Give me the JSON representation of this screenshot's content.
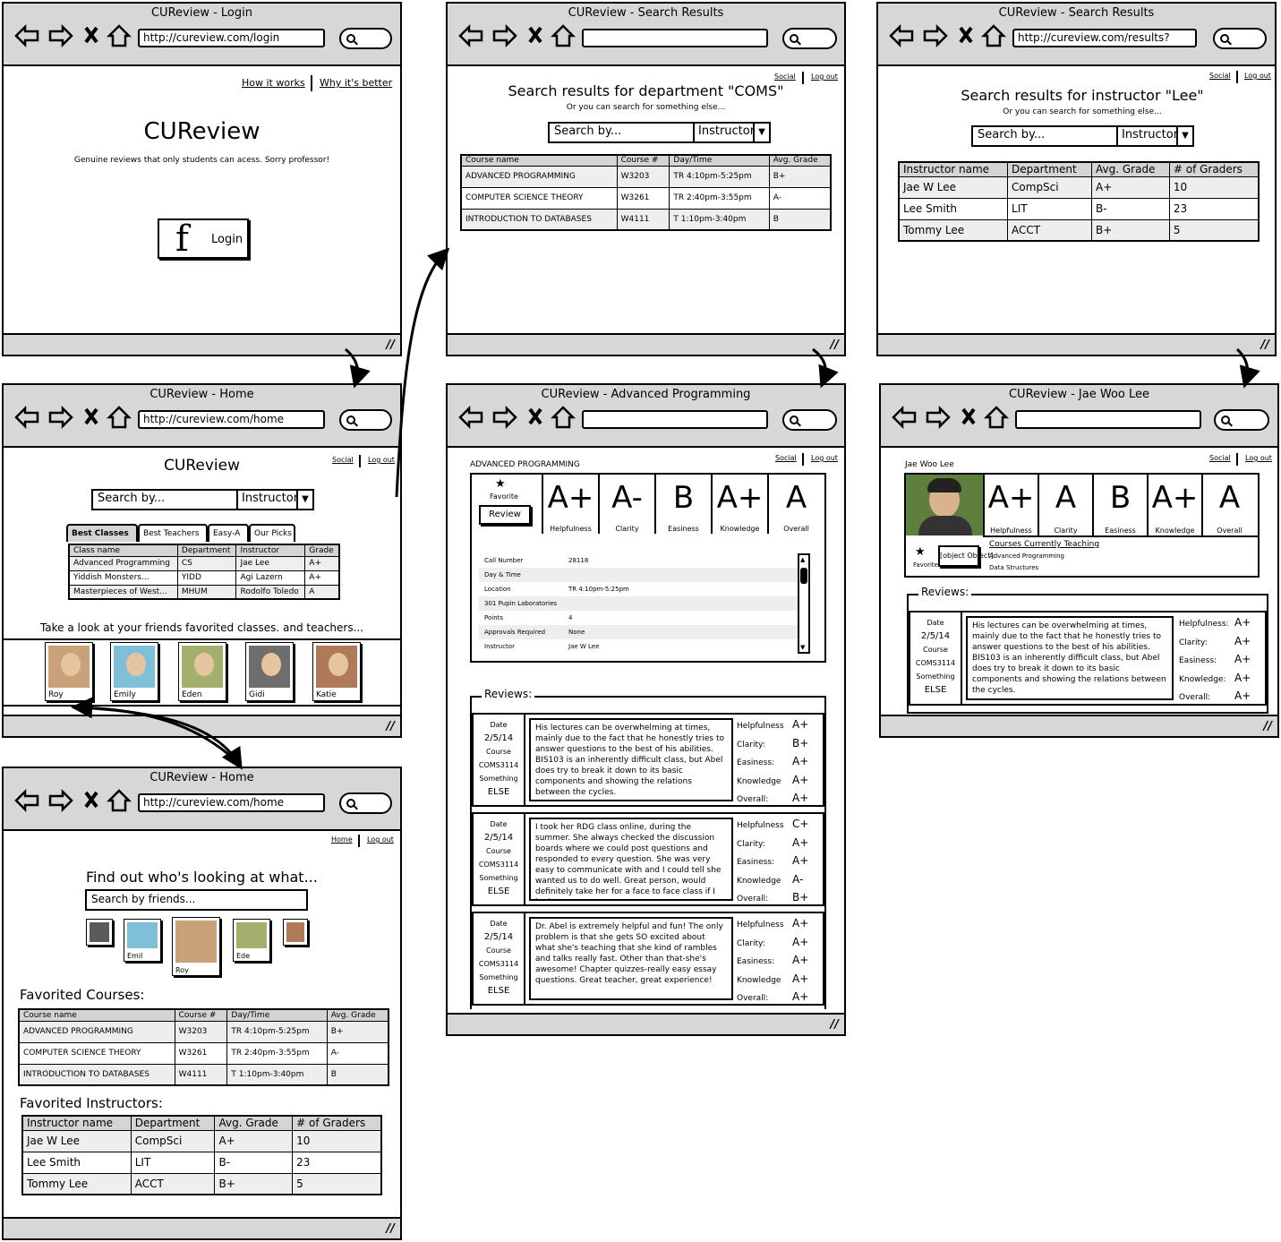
{
  "w1": {
    "title": "CUReview - Login",
    "url": "http://cureview.com/login",
    "link1": "How it works",
    "link2": "Why it's better",
    "heading": "CUReview",
    "tagline": "Genuine reviews that only students can acess. Sorry professor!",
    "login": "Login"
  },
  "w2": {
    "title": "CUReview - Search Results",
    "social": "Social",
    "logout": "Log out",
    "heading": "Search results for department \"COMS\"",
    "sub": "Or you can search for something else...",
    "search_ph": "Search by...",
    "dropdown": "Instructor",
    "headers": [
      "Course name",
      "Course #",
      "Day/Time",
      "Avg. Grade"
    ],
    "rows": [
      [
        "ADVANCED PROGRAMMING",
        "W3203",
        "TR 4:10pm-5:25pm",
        "B+"
      ],
      [
        "COMPUTER SCIENCE THEORY",
        "W3261",
        "TR 2:40pm-3:55pm",
        "A-"
      ],
      [
        "INTRODUCTION TO DATABASES",
        "W4111",
        "T 1:10pm-3:40pm",
        "B"
      ]
    ]
  },
  "w3": {
    "title": "CUReview - Search Results",
    "url": "http://cureview.com/results?",
    "social": "Social",
    "logout": "Log out",
    "heading": "Search results for instructor \"Lee\"",
    "sub": "Or you can search for something else...",
    "search_ph": "Search by...",
    "dropdown": "Instructor",
    "headers": [
      "Instructor name",
      "Department",
      "Avg. Grade",
      "# of Graders"
    ],
    "rows": [
      [
        "Jae W Lee",
        "CompSci",
        "A+",
        "10"
      ],
      [
        "Lee Smith",
        "LIT",
        "B-",
        "23"
      ],
      [
        "Tommy Lee",
        "ACCT",
        "B+",
        "5"
      ]
    ]
  },
  "w4": {
    "title": "CUReview - Home",
    "url": "http://cureview.com/home",
    "social": "Social",
    "logout": "Log out",
    "heading": "CUReview",
    "search_ph": "Search by...",
    "dropdown": "Instructor",
    "tabs": [
      "Best Classes",
      "Best Teachers",
      "Easy-A",
      "Our Picks"
    ],
    "headers": [
      "Class name",
      "Department",
      "Instructor",
      "Grade"
    ],
    "rows": [
      [
        "Advanced Programming",
        "CS",
        "Jae Lee",
        "A+"
      ],
      [
        "Yiddish Monsters...",
        "YIDD",
        "Agi Lazern",
        "A+"
      ],
      [
        "Masterpieces of West...",
        "MHUM",
        "Rodolfo Toledo",
        "A"
      ]
    ],
    "friends_caption": "Take a look at your friends favorited classes. and teachers...",
    "friends": [
      "Roy",
      "Emily",
      "Eden",
      "Gidi",
      "Katie"
    ]
  },
  "w5": {
    "title": "CUReview - Advanced Programming",
    "social": "Social",
    "logout": "Log out",
    "course": "ADVANCED PROGRAMMING",
    "favorite": "Favorite",
    "review": "Review",
    "grades": [
      {
        "g": "A+",
        "l": "Helpfulness"
      },
      {
        "g": "A-",
        "l": "Clarity"
      },
      {
        "g": "B",
        "l": "Easiness"
      },
      {
        "g": "A+",
        "l": "Knowledge"
      },
      {
        "g": "A",
        "l": "Overall"
      }
    ],
    "details": [
      [
        "Call Number",
        "28118"
      ],
      [
        "Day & Time",
        ""
      ],
      [
        "Location",
        "TR 4:10pm-5:25pm"
      ],
      [
        "301 Pupin Laboratories",
        ""
      ],
      [
        "Points",
        "4"
      ],
      [
        "Approvals Required",
        "None"
      ],
      [
        "Instructor",
        "Jae W Lee"
      ]
    ],
    "reviews_label": "Reviews:",
    "reviews": [
      {
        "date_l": "Date",
        "date": "2/5/14",
        "course_l": "Course",
        "course": "COMS3114",
        "s1": "Something",
        "s2": "ELSE",
        "text": "His lectures can be overwhelming at times, mainly due to the fact that he honestly tries to answer questions to the best of his abilities. BIS103 is an inherently difficult class, but Abel does try to break it down to its basic components and showing the relations between the cycles.",
        "r": [
          [
            "Helpfulness",
            "A+"
          ],
          [
            "Clarity:",
            "B+"
          ],
          [
            "Easiness:",
            "A+"
          ],
          [
            "Knowledge",
            "A+"
          ],
          [
            "Overall:",
            "A+"
          ]
        ]
      },
      {
        "date_l": "Date",
        "date": "2/5/14",
        "course_l": "Course",
        "course": "COMS3114",
        "s1": "Something",
        "s2": "ELSE",
        "text": "I took her RDG class online, during the summer. She always checked the discussion boards where we could post questions and responded to every question. She was very easy to communicate with and I could tell she wanted us to do well. Great person, would definitely take her for a face to face class if I had to.",
        "r": [
          [
            "Helpfulness",
            "C+"
          ],
          [
            "Clarity:",
            "A+"
          ],
          [
            "Easiness:",
            "A+"
          ],
          [
            "Knowledge",
            "A-"
          ],
          [
            "Overall:",
            "B+"
          ]
        ]
      },
      {
        "date_l": "Date",
        "date": "2/5/14",
        "course_l": "Course",
        "course": "COMS3114",
        "s1": "Something",
        "s2": "ELSE",
        "text": "Dr. Abel is extremely helpful and fun! The only problem is that she gets SO excited about what she's teaching that she kind of rambles and talks really fast. Other than that-she's awesome! Chapter quizzes-really easy essay questions. Great teacher, great experience!",
        "r": [
          [
            "Helpfulness",
            "A+"
          ],
          [
            "Clarity:",
            "A+"
          ],
          [
            "Easiness:",
            "A+"
          ],
          [
            "Knowledge",
            "A+"
          ],
          [
            "Overall:",
            "A+"
          ]
        ]
      }
    ]
  },
  "w6": {
    "title": "CUReview - Jae Woo Lee",
    "social": "Social",
    "logout": "Log out",
    "name": "Jae Woo Lee",
    "favorite": "Favorite",
    "review": {
      "date_l": "Date",
      "date": "2/5/14",
      "course_l": "Course",
      "course": "COMS3114",
      "s1": "Something",
      "s2": "ELSE",
      "text": "His lectures can be overwhelming at times, mainly due to the fact that he honestly tries to answer questions to the best of his abilities. BIS103 is an inherently difficult class, but Abel does try to break it down to its basic components and showing the relations between the cycles.",
      "r": [
        [
          "Helpfulness:",
          "A+"
        ],
        [
          "Clarity:",
          "A+"
        ],
        [
          "Easiness:",
          "A+"
        ],
        [
          "Knowledge:",
          "A+"
        ],
        [
          "Overall:",
          "A+"
        ]
      ]
    },
    "grades": [
      {
        "g": "A+",
        "l": "Helpfulness"
      },
      {
        "g": "A",
        "l": "Clarity"
      },
      {
        "g": "B",
        "l": "Easiness"
      },
      {
        "g": "A+",
        "l": "Knowledge"
      },
      {
        "g": "A",
        "l": "Overall"
      }
    ],
    "courses_label": "Courses Currently Teaching",
    "courses": [
      "Advanced Programming",
      "Data Structures"
    ],
    "reviews_label": "Reviews:"
  },
  "w7": {
    "title": "CUReview - Home",
    "url": "http://cureview.com/home",
    "home": "Home",
    "logout": "Log out",
    "heading": "Find out who's looking at what...",
    "search_ph": "Search by friends...",
    "friends": [
      "",
      "Emil",
      "Roy",
      "Ede",
      ""
    ],
    "fav_courses_label": "Favorited Courses:",
    "course_headers": [
      "Course name",
      "Course #",
      "Day/Time",
      "Avg. Grade"
    ],
    "course_rows": [
      [
        "ADVANCED PROGRAMMING",
        "W3203",
        "TR 4:10pm-5:25pm",
        "B+"
      ],
      [
        "COMPUTER SCIENCE THEORY",
        "W3261",
        "TR 2:40pm-3:55pm",
        "A-"
      ],
      [
        "INTRODUCTION TO DATABASES",
        "W4111",
        "T 1:10pm-3:40pm",
        "B"
      ]
    ],
    "fav_instr_label": "Favorited Instructors:",
    "instr_headers": [
      "Instructor name",
      "Department",
      "Avg. Grade",
      "# of Graders"
    ],
    "instr_rows": [
      [
        "Jae W Lee",
        "CompSci",
        "A+",
        "10"
      ],
      [
        "Lee Smith",
        "LIT",
        "B-",
        "23"
      ],
      [
        "Tommy Lee",
        "ACCT",
        "B+",
        "5"
      ]
    ]
  },
  "colors": {
    "chrome": "#d7d7d7",
    "table_header": "#d4d4d4",
    "stripe": "#eeeeee"
  }
}
